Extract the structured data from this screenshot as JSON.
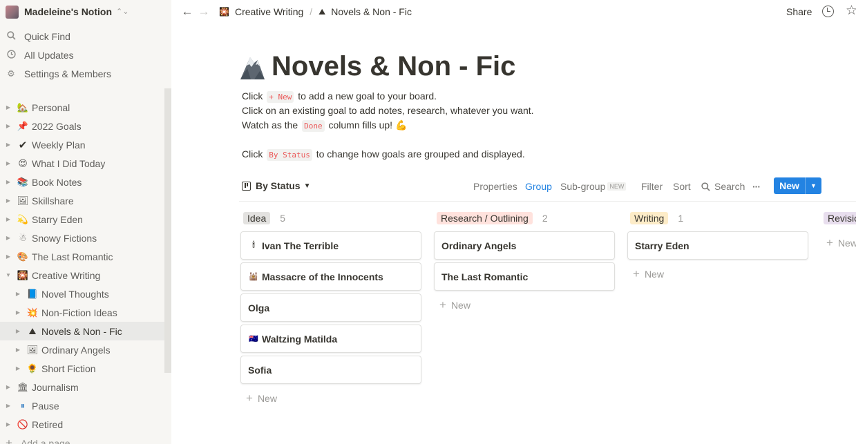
{
  "workspace": {
    "name": "Madeleine's Notion",
    "switch_icon": "chevron-up-down-icon"
  },
  "sidebar": {
    "utilities": [
      {
        "label": "Quick Find",
        "icon": "search-icon"
      },
      {
        "label": "All Updates",
        "icon": "clock-icon"
      },
      {
        "label": "Settings & Members",
        "icon": "gear-icon"
      }
    ],
    "pages": [
      {
        "label": "Personal",
        "icon": "house-icon",
        "glyph": "🏡",
        "level": 0,
        "expanded": false
      },
      {
        "label": "2022 Goals",
        "icon": "pin-icon",
        "glyph": "📌",
        "level": 0,
        "expanded": false
      },
      {
        "label": "Weekly Plan",
        "icon": "checkmark-icon",
        "glyph": "✔",
        "level": 0,
        "expanded": false
      },
      {
        "label": "What I Did Today",
        "icon": "smiling-face-heart-eyes-icon",
        "glyph": "😍",
        "level": 0,
        "expanded": false
      },
      {
        "label": "Book Notes",
        "icon": "books-icon",
        "glyph": "📚",
        "level": 0,
        "expanded": false
      },
      {
        "label": "Skillshare",
        "icon": "picture-icon",
        "glyph": "🖼",
        "level": 0,
        "expanded": false
      },
      {
        "label": "Starry Eden",
        "icon": "dizzy-star-icon",
        "glyph": "💫",
        "level": 0,
        "expanded": false
      },
      {
        "label": "Snowy Fictions",
        "icon": "snowman-icon",
        "glyph": "☃",
        "level": 0,
        "expanded": false
      },
      {
        "label": "The Last Romantic",
        "icon": "painting-icon",
        "glyph": "🎨",
        "level": 0,
        "expanded": false
      },
      {
        "label": "Creative Writing",
        "icon": "sparkler-icon",
        "glyph": "🎇",
        "level": 0,
        "expanded": true
      },
      {
        "label": "Novel Thoughts",
        "icon": "blue-book-icon",
        "glyph": "📘",
        "level": 1,
        "expanded": false
      },
      {
        "label": "Non-Fiction Ideas",
        "icon": "explosion-icon",
        "glyph": "💥",
        "level": 1,
        "expanded": false
      },
      {
        "label": "Novels & Non - Fic",
        "icon": "mountain-icon",
        "glyph": "⛰",
        "level": 1,
        "expanded": false,
        "active": true
      },
      {
        "label": "Ordinary Angels",
        "icon": "portrait-icon",
        "glyph": "🖼",
        "level": 1,
        "expanded": false
      },
      {
        "label": "Short Fiction",
        "icon": "sunflower-icon",
        "glyph": "🌻",
        "level": 1,
        "expanded": false
      },
      {
        "label": "Journalism",
        "icon": "building-icon",
        "glyph": "🏛",
        "level": 0,
        "expanded": false
      },
      {
        "label": "Pause",
        "icon": "pause-icon",
        "glyph": "⏸",
        "level": 0,
        "expanded": false
      },
      {
        "label": "Retired",
        "icon": "prohibited-icon",
        "glyph": "🚫",
        "level": 0,
        "expanded": false
      }
    ],
    "add_page": "Add a page"
  },
  "topbar": {
    "breadcrumb": [
      {
        "label": "Creative Writing",
        "icon": "sparkler-icon",
        "glyph": "🎇"
      },
      {
        "label": "Novels & Non - Fic",
        "icon": "mountain-icon",
        "glyph": "⛰"
      }
    ],
    "separator": "/",
    "share_label": "Share"
  },
  "page": {
    "title": "Novels & Non - Fic",
    "icon": "mountain-icon",
    "desc1": {
      "pre": "Click ",
      "code": "+ New",
      "post": " to add a new goal to your board."
    },
    "desc2": "Click on an existing goal to add notes, research, whatever you want.",
    "desc3": {
      "pre": "Watch as the ",
      "code": "Done",
      "post": " column fills up! ",
      "emoji": "💪"
    },
    "desc4": {
      "pre": "Click ",
      "code": "By Status",
      "post": " to change how goals are grouped and displayed."
    }
  },
  "view": {
    "name": "By Status",
    "properties": "Properties",
    "group": "Group",
    "subgroup": "Sub-group",
    "subgroup_badge": "NEW",
    "filter": "Filter",
    "sort": "Sort",
    "search": "Search",
    "more": "···",
    "new_label": "New"
  },
  "board": {
    "new_label": "New",
    "columns": [
      {
        "name": "Idea",
        "count": "5",
        "color": "#e3e2e0",
        "cards": [
          {
            "title": "Ivan The Terrible",
            "glyph": "🕯"
          },
          {
            "title": "Massacre of the Innocents",
            "glyph": "🕍"
          },
          {
            "title": "Olga",
            "glyph": ""
          },
          {
            "title": "Waltzing Matilda",
            "glyph": "🇦🇺"
          },
          {
            "title": "Sofia",
            "glyph": ""
          }
        ]
      },
      {
        "name": "Research / Outlining",
        "count": "2",
        "color": "#ffe2dd",
        "cards": [
          {
            "title": "Ordinary Angels",
            "glyph": ""
          },
          {
            "title": "The Last Romantic",
            "glyph": ""
          }
        ]
      },
      {
        "name": "Writing",
        "count": "1",
        "color": "#fdecc8",
        "cards": [
          {
            "title": "Starry Eden",
            "glyph": ""
          }
        ]
      },
      {
        "name": "Revisio",
        "count": "",
        "color": "#e8deee",
        "cards": []
      }
    ]
  }
}
